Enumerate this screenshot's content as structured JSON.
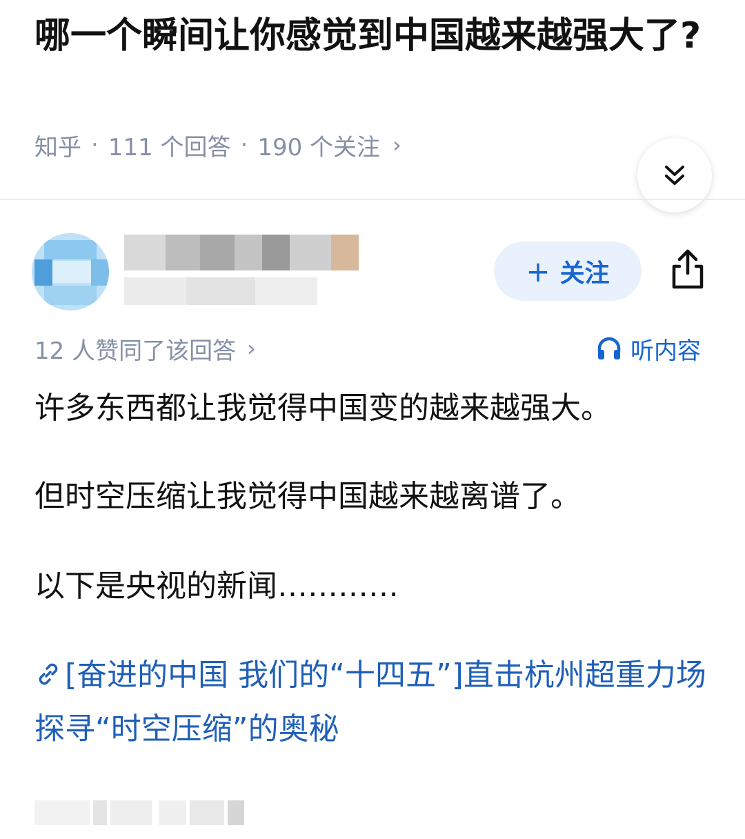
{
  "question": {
    "title": "哪一个瞬间让你感觉到中国越来越强大了?",
    "source": "知乎",
    "answer_count": "111 个回答",
    "follower_count": "190 个关注",
    "separator": "·",
    "more_chevron": "›"
  },
  "answer": {
    "follow_plus": "+",
    "follow_label": "关注",
    "vote_text": "12 人赞同了该回答",
    "vote_chevron": "›",
    "listen_label": "听内容",
    "paragraphs": [
      "许多东西都让我觉得中国变的越来越强大。",
      "但时空压缩让我觉得中国越来越离谱了。",
      "以下是央视的新闻…………"
    ],
    "link_text": "[奋进的中国 我们的“十四五”]直击杭州超重力场 探寻“时空压缩”的奥秘"
  },
  "icons": {
    "expand": "double-chevron-down-icon",
    "share": "share-icon",
    "listen": "headphones-icon",
    "link": "link-icon"
  },
  "colors": {
    "accent_blue": "#1765d0",
    "link_blue": "#1f5fb8",
    "meta_gray": "#8590a6",
    "follow_bg": "#e9f1fd"
  }
}
